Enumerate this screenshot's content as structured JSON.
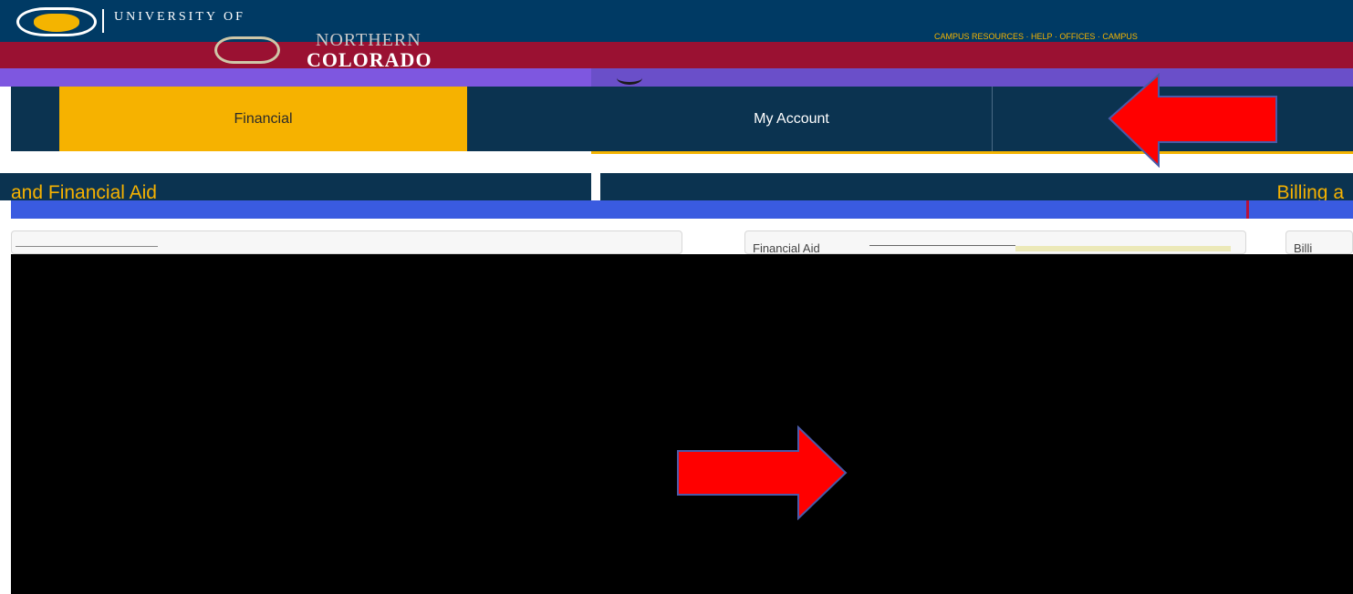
{
  "header": {
    "university_of": "UNIVERSITY OF",
    "northern": "NORTHERN",
    "colorado": "COLORADO",
    "top_links": "CAMPUS RESOURCES · HELP · OFFICES · CAMPUS"
  },
  "nav": {
    "tabs": [
      {
        "label": "Financial",
        "active": true
      },
      {
        "label": "My Account",
        "active": false
      }
    ]
  },
  "sections": {
    "left_title": "and Financial Aid",
    "right_title": "Billing a"
  },
  "panels": {
    "middle_label": "Financial Aid",
    "right_label": "Billi"
  },
  "colors": {
    "navy": "#0b3350",
    "gold": "#f6b200",
    "crimson": "#9a1132",
    "arrow_red": "#ff0000"
  },
  "annotations": {
    "arrow_icons": [
      "left-arrow-icon",
      "right-arrow-icon"
    ]
  }
}
